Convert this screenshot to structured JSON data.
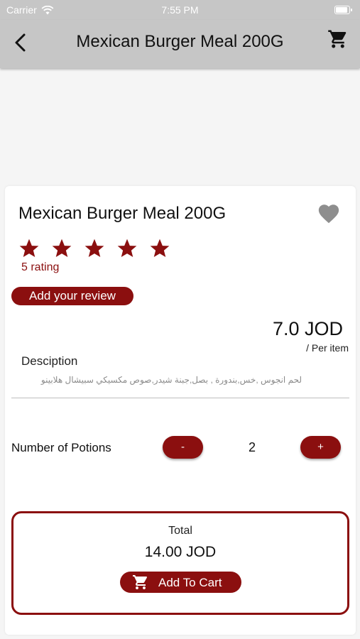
{
  "status_bar": {
    "carrier": "Carrier",
    "time": "7:55 PM"
  },
  "header": {
    "title": "Mexican Burger Meal 200G",
    "back_icon": "chevron-left-icon",
    "cart_icon": "shopping-cart-icon"
  },
  "product": {
    "name": "Mexican Burger Meal 200G",
    "favorite_icon": "heart-icon",
    "stars": 5,
    "rating_text": "5 rating",
    "review_button": "Add your review",
    "price": "7.0 JOD",
    "per_item": "/ Per item",
    "description_label": "Desciption",
    "description": "لحم انجوس ,خس,بندورة , بصل,جبنة شيدر,صوص مكسيكي سبيشال هلابينو"
  },
  "quantity": {
    "label": "Number of Potions",
    "minus_label": "-",
    "plus_label": "+",
    "value": "2"
  },
  "total": {
    "label": "Total",
    "value": "14.00 JOD",
    "add_to_cart_label": "Add To Cart"
  },
  "colors": {
    "accent": "#8b0f0f",
    "header_bg": "#c6c6c6",
    "heart": "#8e8e8e"
  }
}
